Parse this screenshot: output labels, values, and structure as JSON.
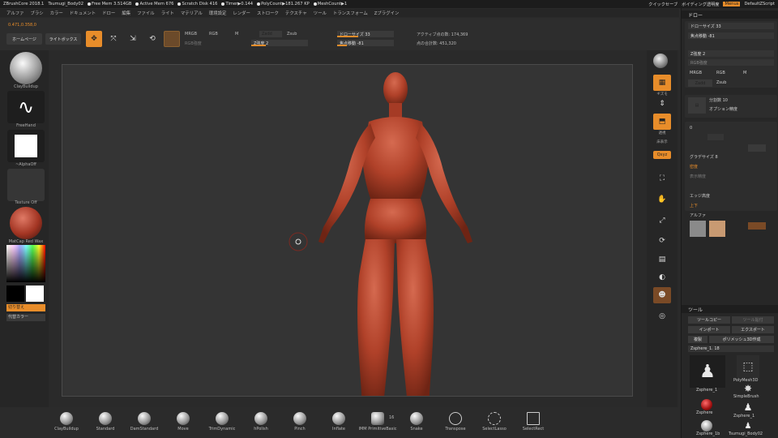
{
  "titlebar": {
    "app": "ZBrushCore 2018.1",
    "project": "Tsumugi_Body02",
    "stats": [
      "Free Mem 3.514GB",
      "Active Mem 676",
      "Scratch Disk 416",
      "Timer▶0.144",
      "PolyCount▶181.267 KP",
      "MeshCount▶1"
    ],
    "quicksave": "クイックセーブ",
    "transparency": "ボイディング透明度",
    "menus_btn": "Menus",
    "script": "DefaultZScript"
  },
  "menubar": [
    "アルファ",
    "ブラシ",
    "カラー",
    "ドキュメント",
    "ドロー",
    "編集",
    "ファイル",
    "ライト",
    "マテリアル",
    "環境設定",
    "レンダー",
    "ストローク",
    "テクスチャ",
    "ツール",
    "トランスフォーム",
    "Zプラグイン"
  ],
  "toolbar": {
    "coords": "0.471,0.358,0",
    "home_page": "ホームページ",
    "light_box": "ライトボックス",
    "edit_label": "編集",
    "move_label": "移動",
    "scale_label": "スケール",
    "rotate_label": "回転",
    "mrgb": "MRGB",
    "rgb": "RGB",
    "m": "M",
    "zadd": "Zadd",
    "zsub": "Zsub",
    "rgb_intensity": "RGB強度",
    "z_intensity": "Z強度 2",
    "draw_size": "ドローサイズ 33",
    "focal_shift": "焦点移動 -81",
    "active_points": "アクティブ点の数: 174,369",
    "total_points": "点の合計数: 451,320"
  },
  "leftshelf": {
    "brush": "ClayBuildup",
    "stroke": "FreeHand",
    "alpha": "~AlphaOff",
    "texture": "Texture Off",
    "material": "MatCap Red Wax",
    "swatch_label": "切り替え",
    "gradient_label": "代替カラー"
  },
  "rightshelf": [
    {
      "label": "",
      "icon": "sphere-icon"
    },
    {
      "label": "ギズモ",
      "icon": "gizmo-icon"
    },
    {
      "label": "",
      "icon": "move-arrows-icon"
    },
    {
      "label": "透視",
      "icon": "perspective-icon"
    },
    {
      "label": "床表示",
      "icon": "floor-icon"
    },
    {
      "label": "Qxyz",
      "icon": "axis-icon"
    },
    {
      "label": "フレーム",
      "icon": "frame-icon"
    },
    {
      "label": "移動",
      "icon": "move-icon"
    },
    {
      "label": "スケール",
      "icon": "scale-icon"
    },
    {
      "label": "回転",
      "icon": "rotate-icon"
    },
    {
      "label": "ポリフレーム",
      "icon": "polyframe-icon"
    },
    {
      "label": "",
      "icon": "transp-icon"
    },
    {
      "label": "",
      "icon": "solo-icon"
    },
    {
      "label": "",
      "icon": "xpose-icon"
    }
  ],
  "rpanel": {
    "draw_header": "ドロー",
    "draw_size": "ドローサイズ 33",
    "focal_shift": "焦点移動 -81",
    "z_intensity": "Z強度 2",
    "rgb_intensity": "RGB強度",
    "mrgb": "MRGB",
    "rgb": "RGB",
    "m": "M",
    "zadd": "Zadd",
    "zsub": "Zsub",
    "subdiv": "分割数 10",
    "dynamic": "ダイナミック",
    "polish": "オプション精度",
    "brush_row": "0",
    "mask_label": "マスク",
    "gradient_size": "グラデサイズ 8",
    "density": "密度",
    "dense_sub": "表示精度",
    "curve_label": "エッジ高度",
    "up_down": "上下",
    "alpha_label": "アルファ",
    "tool_header": "ツール",
    "tool_copy": "ツールコピー",
    "tool_paste": "ツール貼付",
    "import": "インポート",
    "export": "エクスポート",
    "clone": "複製",
    "append_multiple": "ポリメッシュ3D作成",
    "subtool_name": "Zsphere_1. 18",
    "tools": [
      {
        "name": "Zsphere_1",
        "icon": "figure-icon"
      },
      {
        "name": "PolyMesh3D",
        "icon": "polymesh-icon"
      },
      {
        "name": "SimpleBrush",
        "icon": "star-icon"
      },
      {
        "name": "Zsphere",
        "icon": "zsphere-icon"
      },
      {
        "name": "Zsphere_1",
        "icon": "figure-icon"
      },
      {
        "name": "Zsphere_1b",
        "icon": "figure-icon"
      },
      {
        "name": "Tsumugi_Body02",
        "icon": "figure-icon"
      }
    ]
  },
  "bottombar": {
    "brushes": [
      "ClayBuildup",
      "Standard",
      "DamStandard",
      "Move",
      "TrimDynamic",
      "hPolish",
      "Pinch",
      "Inflate",
      "IMM PrimitiveBasic",
      "Snake",
      "Transpose",
      "SelectLasso",
      "SelectRect"
    ],
    "brush_count": "16"
  },
  "colors": {
    "accent": "#e88d2a",
    "viewport_bg": "#343434",
    "figure": "#b8442e"
  }
}
